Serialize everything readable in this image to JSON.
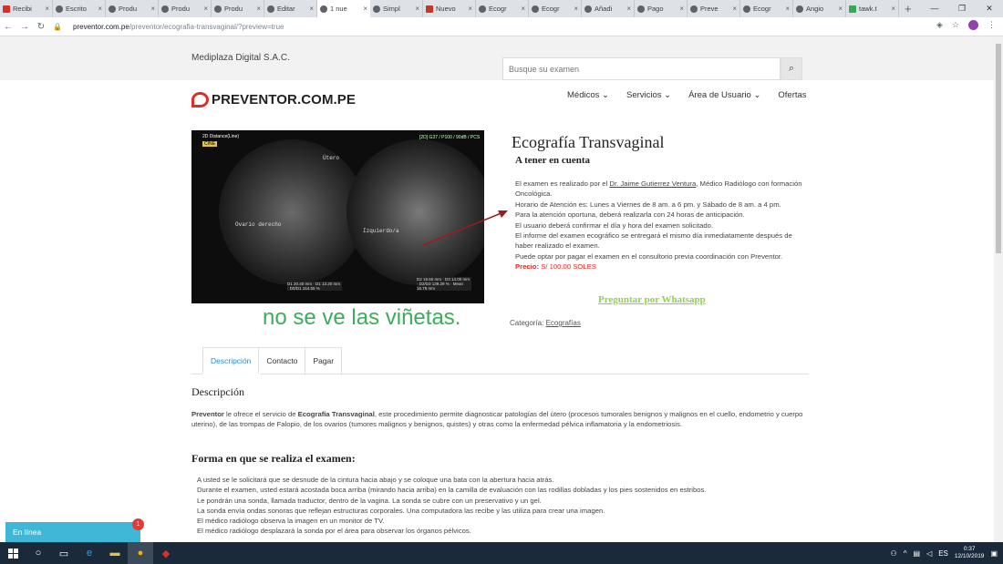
{
  "browser": {
    "tabs": [
      {
        "label": "Recibi",
        "icon": "gmail-icon"
      },
      {
        "label": "Escrito",
        "icon": "wordpress-icon"
      },
      {
        "label": "Produ",
        "icon": "wordpress-icon"
      },
      {
        "label": "Produ",
        "icon": "wordpress-icon"
      },
      {
        "label": "Produ",
        "icon": "wordpress-icon"
      },
      {
        "label": "Editar",
        "icon": "wordpress-icon"
      },
      {
        "label": "1 nue",
        "icon": "wordpress-icon",
        "active": true
      },
      {
        "label": "Simpl",
        "icon": "wordpress-icon"
      },
      {
        "label": "Nuevo",
        "icon": "site-icon"
      },
      {
        "label": "Ecogr",
        "icon": "wordpress-icon"
      },
      {
        "label": "Ecogr",
        "icon": "wordpress-icon"
      },
      {
        "label": "Añadi",
        "icon": "wordpress-icon"
      },
      {
        "label": "Pago",
        "icon": "wordpress-icon"
      },
      {
        "label": "Preve",
        "icon": "wordpress-icon"
      },
      {
        "label": "Ecogr",
        "icon": "wordpress-icon"
      },
      {
        "label": "Angio",
        "icon": "wordpress-icon"
      },
      {
        "label": "tawk.t",
        "icon": "tawk-icon"
      }
    ],
    "url_host": "preventor.com.pe",
    "url_path": "/preventor/ecografia-transvaginal/?preview=true"
  },
  "header": {
    "company": "Mediplaza Digital S.A.C.",
    "search_placeholder": "Busque su examen",
    "logo_text": "PREVENTOR.COM.PE",
    "nav": [
      {
        "label": "Médicos",
        "has_dropdown": true
      },
      {
        "label": "Servicios",
        "has_dropdown": true
      },
      {
        "label": "Área de Usuario",
        "has_dropdown": true
      },
      {
        "label": "Ofertas",
        "has_dropdown": false
      }
    ]
  },
  "image_overlay": {
    "mode": "2D Distance(Line)",
    "tag": "CINE",
    "settings": "[2D] G37 / P100 / 90dB / PCS",
    "label_utero": "Útero",
    "label_ovario": "Ovario derecho",
    "label_izquierdo": "Izquierdo/a",
    "measurements_left": "D1 20.40 mm · D1 13.20 mm · D0/D1 154.55 %",
    "measurements_right": "D2 19.55 mm · D3 14.00 mm · D2/D3 139.29 % · Mean 16.78 mm"
  },
  "annotation": "no se ve las viñetas.",
  "product": {
    "title": "Ecografía Transvaginal",
    "subtitle": "A tener en cuenta",
    "line1_pre": "El examen es realizado por el ",
    "doctor": "Dr. Jaime Gutierrez Ventura",
    "line1_post": ", Médico Radiólogo con formación Oncológica.",
    "lines": [
      "Horario de Atención es: Lunes a Viernes de 8 am. a 6 pm. y Sábado de 8 am. a 4 pm.",
      "Para la atención oportuna, deberá realizarla con 24 horas de anticipación.",
      "El usuario deberá confirmar el día y hora del examen solicitado.",
      "El informe del examen ecográfico se entregará el mismo día inmediatamente después de haber realizado el examen.",
      "Puede optar por pagar el examen en el consultorio previa coordinación con Preventor."
    ],
    "price_label": "Precio:",
    "price_value": " S/ 100.00 SOLES",
    "whatsapp": "Preguntar por Whatsapp",
    "category_label": "Categoría: ",
    "category_value": "Ecografías"
  },
  "tabs": [
    {
      "label": "Descripción",
      "active": true
    },
    {
      "label": "Contacto",
      "active": false
    },
    {
      "label": "Pagar",
      "active": false
    }
  ],
  "description": {
    "heading": "Descripción",
    "brand": "Preventor",
    "mid1": " le ofrece el servicio de ",
    "service": "Ecografía Transvaginal",
    "rest": ", este procedimiento permite diagnosticar patologías del útero (procesos tumorales benignos y malignos en el cuello, endometrio y cuerpo uterino), de las trompas de Falopio, de los ovarios (tumores malignos y benignos, quistes) y otras como la enfermedad pélvica inflamatoria y la endometriosis.",
    "procedure_heading": "Forma en que se realiza el examen:",
    "steps": [
      "A usted se le solicitará que se desnude de la cintura hacia abajo y se coloque una bata con la abertura hacia atrás.",
      "Durante el examen, usted estará acostada boca arriba (mirando hacia arriba) en la camilla de evaluación con las rodillas dobladas y los pies sostenidos en estribos.",
      "Le pondrán una sonda, llamada traductor, dentro de la vagina. La sonda se cubre con un preservativo y un gel.",
      "La sonda envía ondas sonoras que reflejan estructuras corporales. Una computadora las recibe y las utiliza para crear una imagen.",
      "El médico radiólogo observa la imagen en un monitor de TV.",
      "El médico radiólogo desplazará la sonda por el área para observar los órganos pélvicos."
    ]
  },
  "chat": {
    "label": "En línea",
    "badge": "1"
  },
  "taskbar": {
    "time": "0:37",
    "date": "12/10/2019"
  }
}
